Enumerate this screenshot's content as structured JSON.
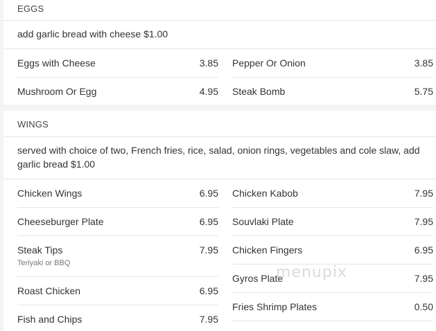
{
  "sections": [
    {
      "title": "EGGS",
      "description": "add garlic bread with cheese $1.00",
      "left_items": [
        {
          "name": "Eggs with Cheese",
          "price": "3.85"
        },
        {
          "name": "Mushroom Or Egg",
          "price": "4.95"
        }
      ],
      "right_items": [
        {
          "name": "Pepper Or Onion",
          "price": "3.85"
        },
        {
          "name": "Steak Bomb",
          "price": "5.75"
        }
      ]
    },
    {
      "title": "WINGS",
      "description": "served with choice of two, French fries, rice, salad, onion rings, vegetables and cole slaw, add garlic bread $1.00",
      "left_items": [
        {
          "name": "Chicken Wings",
          "price": "6.95"
        },
        {
          "name": "Cheeseburger Plate",
          "price": "6.95"
        },
        {
          "name": "Steak Tips",
          "price": "7.95",
          "note": "Teriyaki or BBQ"
        },
        {
          "name": "Roast Chicken",
          "price": "6.95"
        },
        {
          "name": "Fish and Chips",
          "price": "7.95"
        }
      ],
      "right_items": [
        {
          "name": "Chicken Kabob",
          "price": "7.95"
        },
        {
          "name": "Souvlaki Plate",
          "price": "7.95"
        },
        {
          "name": "Chicken Fingers",
          "price": "6.95"
        },
        {
          "name": "Gyros Plate",
          "price": "7.95"
        },
        {
          "name": "Fries Shrimp Plates",
          "price": "0.50"
        }
      ]
    }
  ],
  "watermark": "menupix"
}
